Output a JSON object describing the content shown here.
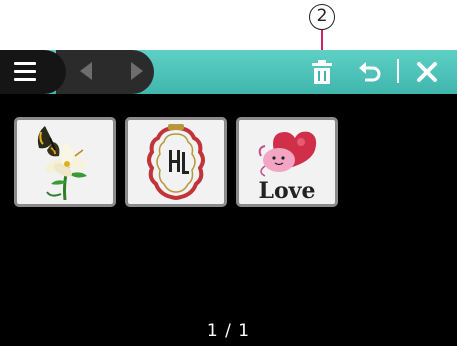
{
  "callout": {
    "number": "2"
  },
  "toolbar": {
    "icons": [
      "menu-icon",
      "prev-arrow-icon",
      "next-arrow-icon",
      "trash-icon",
      "undo-icon",
      "close-icon"
    ],
    "accent_color": "#4cc3b9"
  },
  "designs": [
    {
      "name": "butterfly-lily"
    },
    {
      "name": "hl-monogram-frame"
    },
    {
      "name": "love-heart",
      "text": "Love"
    }
  ],
  "pagination": {
    "label": "1 / 1"
  }
}
